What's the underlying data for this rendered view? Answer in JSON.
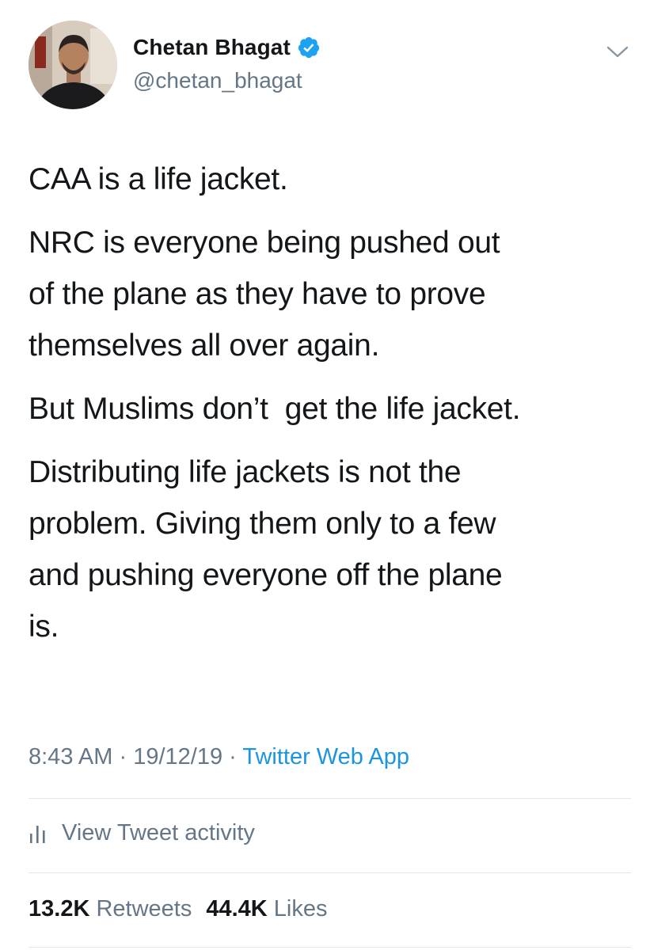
{
  "user": {
    "display_name": "Chetan Bhagat",
    "handle": "@chetan_bhagat",
    "verified": true
  },
  "tweet": {
    "paragraphs": [
      "CAA is a life jacket.",
      "NRC is everyone being pushed out\nof the plane as they have to prove\nthemselves all over again.",
      "But Muslims don’t  get the life jacket.",
      "Distributing life jackets is not the\nproblem. Giving them only to a few\nand pushing everyone off the plane\nis."
    ]
  },
  "meta": {
    "time": "8:43 AM",
    "separator": " · ",
    "date": "19/12/19",
    "source": "Twitter Web App"
  },
  "activity": {
    "label": "View Tweet activity",
    "icon": "bar-chart-icon"
  },
  "stats": {
    "retweets_count": "13.2K",
    "retweets_label": "Retweets",
    "likes_count": "44.4K",
    "likes_label": "Likes"
  },
  "colors": {
    "text": "#14171a",
    "secondary": "#657786",
    "link": "#1b95e0",
    "verified": "#1da1f2",
    "divider": "#e1e8ed"
  }
}
